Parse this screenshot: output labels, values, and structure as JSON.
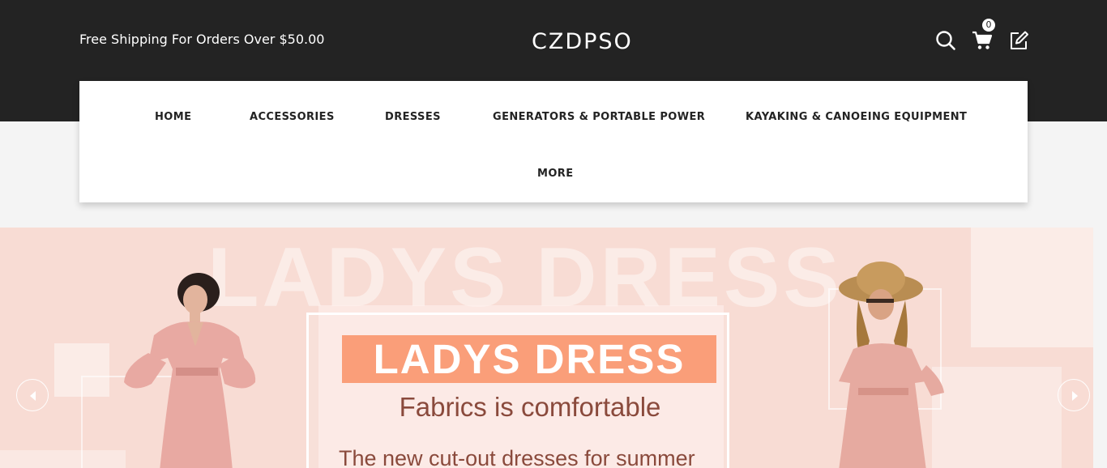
{
  "header": {
    "promo_text": "Free Shipping For Orders Over $50.00",
    "logo_text": "CZDPSO",
    "cart_count": "0",
    "icons": [
      "search-icon",
      "cart-icon",
      "edit-icon"
    ]
  },
  "nav": {
    "items": [
      {
        "label": "HOME"
      },
      {
        "label": "ACCESSORIES"
      },
      {
        "label": "DRESSES"
      },
      {
        "label": "GENERATORS & PORTABLE POWER"
      },
      {
        "label": "KAYAKING & CANOEING EQUIPMENT"
      },
      {
        "label": "MORE"
      }
    ]
  },
  "banner": {
    "background_word": "LADYS DRESS",
    "headline": "LADYS DRESS",
    "subtitle": "Fabrics is comfortable",
    "tagline": "The new cut-out dresses for summer",
    "prev_icon": "chevron-left-icon",
    "next_icon": "chevron-right-icon"
  },
  "colors": {
    "topbar": "#232323",
    "banner_bg": "#f8dcd4",
    "headline_bg": "#fa9e79",
    "text_brown": "#8a4a3c"
  }
}
